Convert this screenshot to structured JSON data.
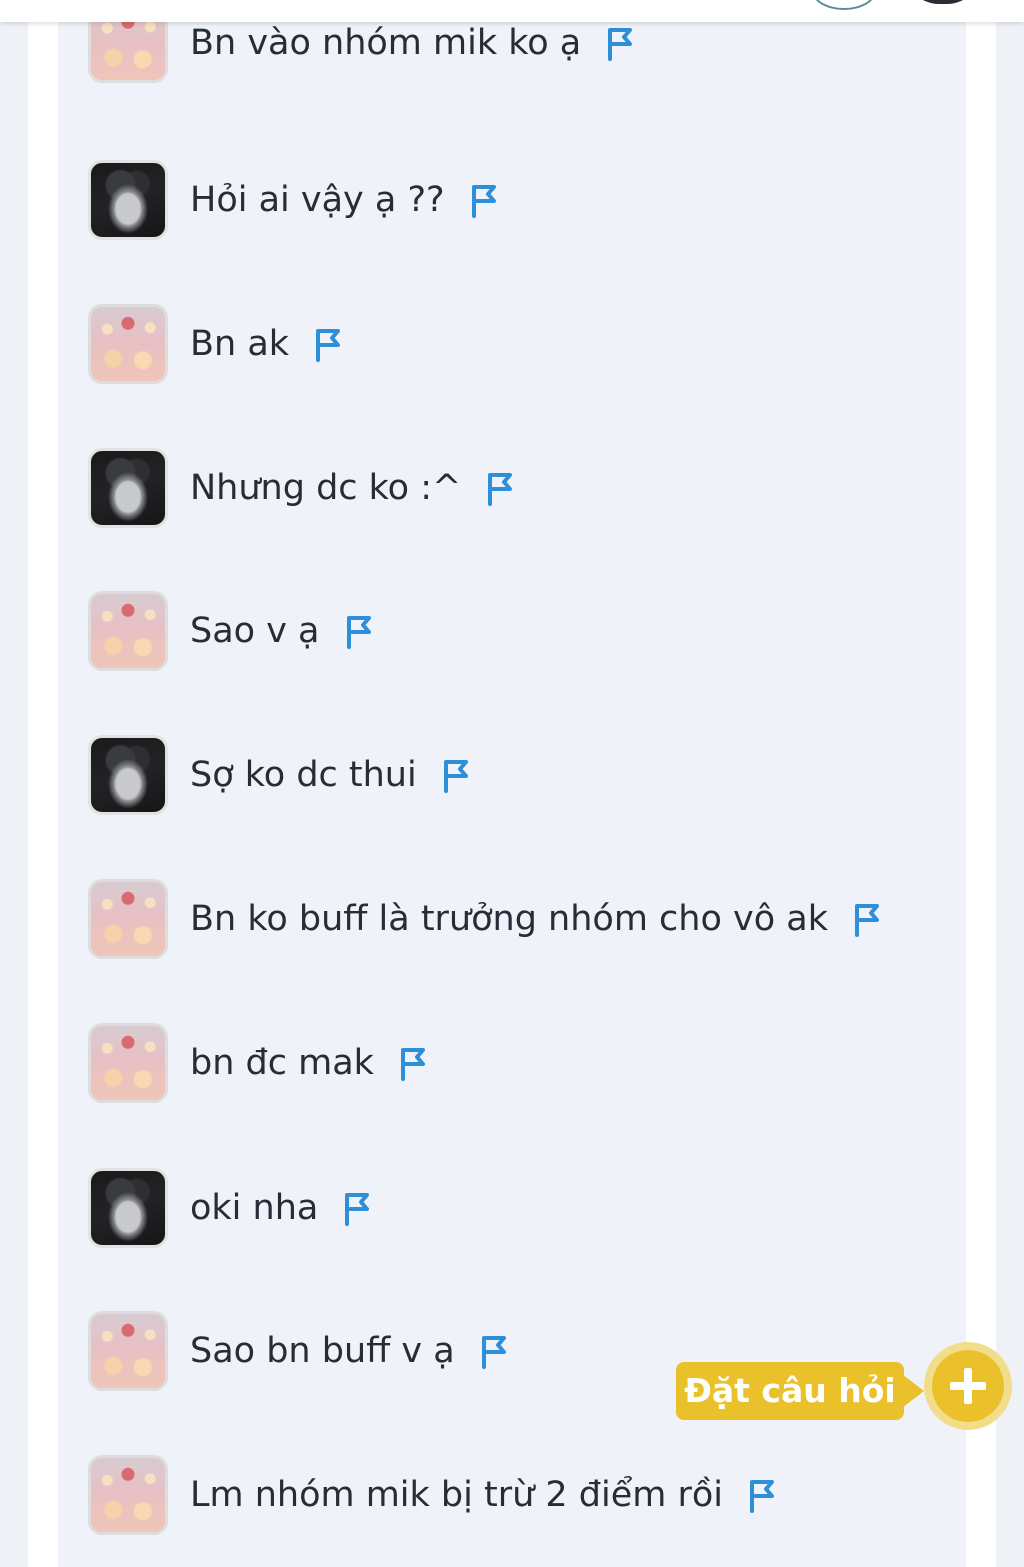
{
  "colors": {
    "panel_background": "#eff2f8",
    "page_background": "#eef1f5",
    "text": "#272c36",
    "flag": "#2e8fd8",
    "accent_yellow": "#eac12a"
  },
  "messages": [
    {
      "avatar": "pink-girl-avatar",
      "text": "Bn vào nhóm mik ko ạ"
    },
    {
      "avatar": "dark-hair-avatar",
      "text": "Hỏi ai vậy ạ ??"
    },
    {
      "avatar": "pink-girl-avatar",
      "text": "Bn ak"
    },
    {
      "avatar": "dark-hair-avatar",
      "text": "Nhưng dc ko :^"
    },
    {
      "avatar": "pink-girl-avatar",
      "text": "Sao v ạ"
    },
    {
      "avatar": "dark-hair-avatar",
      "text": "Sợ ko dc thui"
    },
    {
      "avatar": "pink-girl-avatar",
      "text": "Bn ko buff là trưởng nhóm cho vô ak"
    },
    {
      "avatar": "pink-girl-avatar",
      "text": "bn đc mak"
    },
    {
      "avatar": "dark-hair-avatar",
      "text": "oki nha"
    },
    {
      "avatar": "pink-girl-avatar",
      "text": "Sao bn buff v ạ"
    },
    {
      "avatar": "pink-girl-avatar",
      "text": "Lm nhóm mik bị trừ 2 điểm rồi"
    }
  ],
  "ask_button": {
    "label": "Đặt câu hỏi",
    "icon": "plus-icon"
  }
}
